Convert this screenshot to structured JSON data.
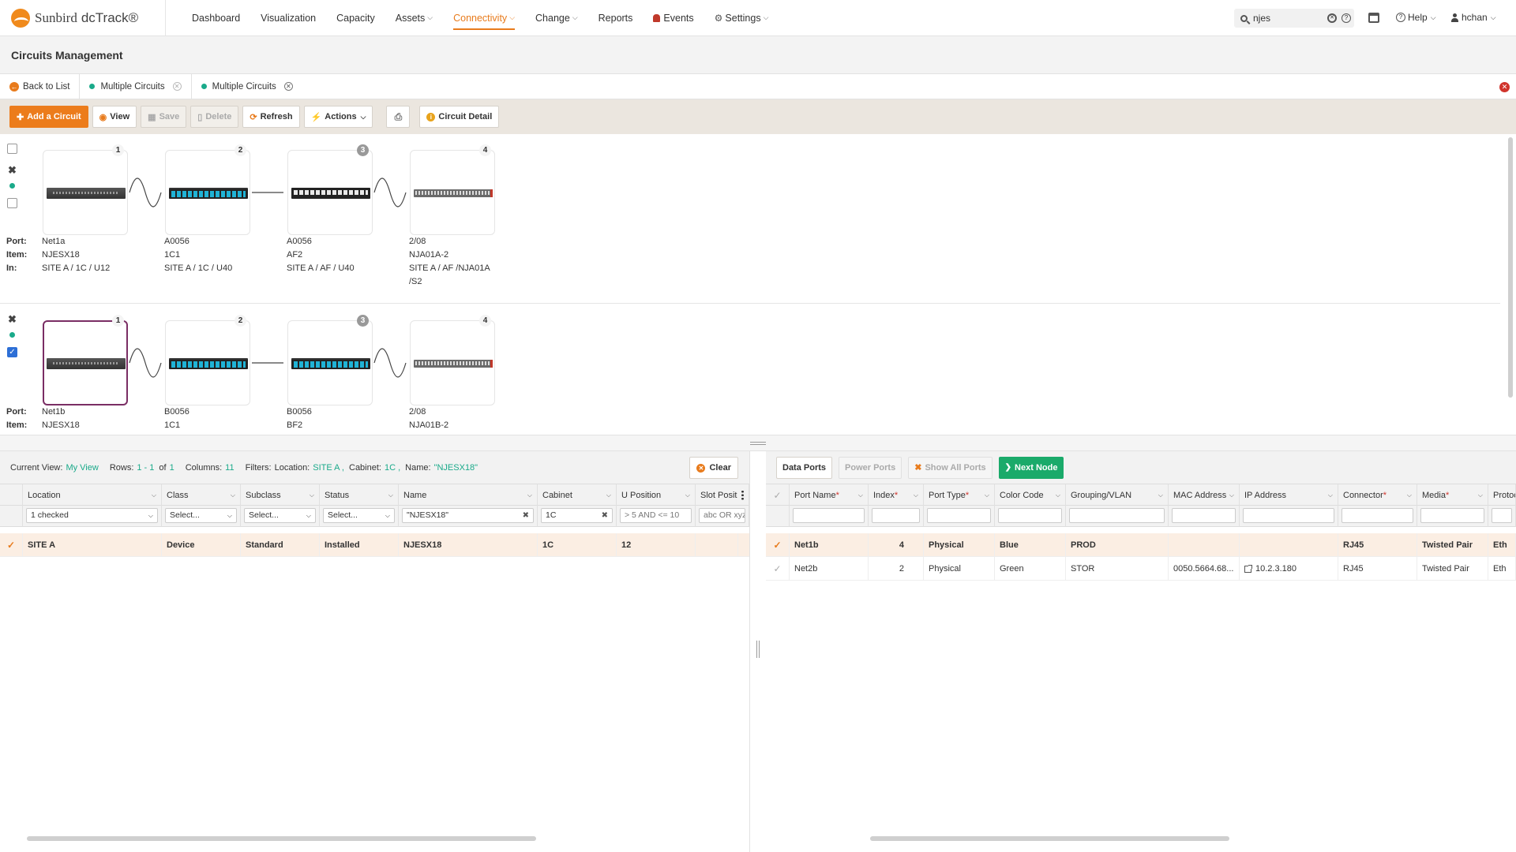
{
  "app": {
    "brand": "Sunbird",
    "product": "dcTrack®"
  },
  "nav": {
    "items": [
      {
        "label": "Dashboard"
      },
      {
        "label": "Visualization"
      },
      {
        "label": "Capacity"
      },
      {
        "label": "Assets"
      },
      {
        "label": "Connectivity"
      },
      {
        "label": "Change"
      },
      {
        "label": "Reports"
      },
      {
        "label": "Events"
      },
      {
        "label": "Settings"
      }
    ],
    "active": "Connectivity",
    "search_value": "njes",
    "help_label": "Help",
    "user_label": "hchan"
  },
  "page": {
    "title": "Circuits Management"
  },
  "tabs": {
    "back_label": "Back to List",
    "items": [
      {
        "label": "Multiple Circuits"
      },
      {
        "label": "Multiple Circuits"
      }
    ]
  },
  "toolbar": {
    "add_label": "Add a Circuit",
    "view_label": "View",
    "save_label": "Save",
    "delete_label": "Delete",
    "refresh_label": "Refresh",
    "actions_label": "Actions",
    "detail_label": "Circuit Detail"
  },
  "circuit_labels": {
    "port": "Port:",
    "item": "Item:",
    "in": "In:"
  },
  "circuits": [
    {
      "nodes": [
        {
          "index": "1",
          "port": "Net1a",
          "item": "NJESX18",
          "in": "SITE A / 1C / U12"
        },
        {
          "index": "2",
          "port": "A0056",
          "item": "1C1",
          "in": "SITE A / 1C / U40"
        },
        {
          "index": "3",
          "port": "A0056",
          "item": "AF2",
          "in": "SITE A / AF / U40"
        },
        {
          "index": "4",
          "port": "2/08",
          "item": "NJA01A-2",
          "in": "SITE A / AF /NJA01A",
          "in2": "/S2"
        }
      ]
    },
    {
      "nodes": [
        {
          "index": "1",
          "port": "Net1b",
          "item": "NJESX18"
        },
        {
          "index": "2",
          "port": "B0056",
          "item": "1C1"
        },
        {
          "index": "3",
          "port": "B0056",
          "item": "BF2"
        },
        {
          "index": "4",
          "port": "2/08",
          "item": "NJA01B-2"
        }
      ]
    }
  ],
  "left_info": {
    "current_view_label": "Current View:",
    "current_view": "My View",
    "rows_label": "Rows:",
    "rows_range": "1 - 1",
    "rows_of": "of",
    "rows_total": "1",
    "columns_label": "Columns:",
    "columns": "11",
    "filters_label": "Filters:",
    "location_label": "Location:",
    "location": "SITE A ,",
    "cabinet_label": "Cabinet:",
    "cabinet": "1C ,",
    "name_label": "Name:",
    "name": "\"NJESX18\"",
    "clear_label": "Clear"
  },
  "left_grid": {
    "headers": [
      "Location",
      "Class",
      "Subclass",
      "Status",
      "Name",
      "Cabinet",
      "U Position",
      "Slot Posit"
    ],
    "filters": [
      "1 checked",
      "Select...",
      "Select...",
      "Select...",
      "\"NJESX18\"",
      "1C",
      "> 5 AND <= 10",
      "abc OR xyz*"
    ],
    "rows": [
      [
        "SITE A",
        "Device",
        "Standard",
        "Installed",
        "NJESX18",
        "1C",
        "12",
        ""
      ]
    ]
  },
  "right_tabs": {
    "data_ports": "Data Ports",
    "power_ports": "Power Ports",
    "show_all_ports": "Show All Ports",
    "next_node": "Next Node"
  },
  "right_grid": {
    "headers": [
      "Port Name",
      "Index",
      "Port Type",
      "Color Code",
      "Grouping/VLAN",
      "MAC Address",
      "IP Address",
      "Connector",
      "Media",
      "Protoc"
    ],
    "required": [
      "Port Name",
      "Index",
      "Port Type",
      "Connector",
      "Media"
    ],
    "rows": [
      [
        "Net1b",
        "4",
        "Physical",
        "Blue",
        "PROD",
        "",
        "",
        "RJ45",
        "Twisted Pair",
        "Eth"
      ],
      [
        "Net2b",
        "2",
        "Physical",
        "Green",
        "STOR",
        "0050.5664.68...",
        "10.2.3.180",
        "RJ45",
        "Twisted Pair",
        "Eth"
      ]
    ]
  }
}
